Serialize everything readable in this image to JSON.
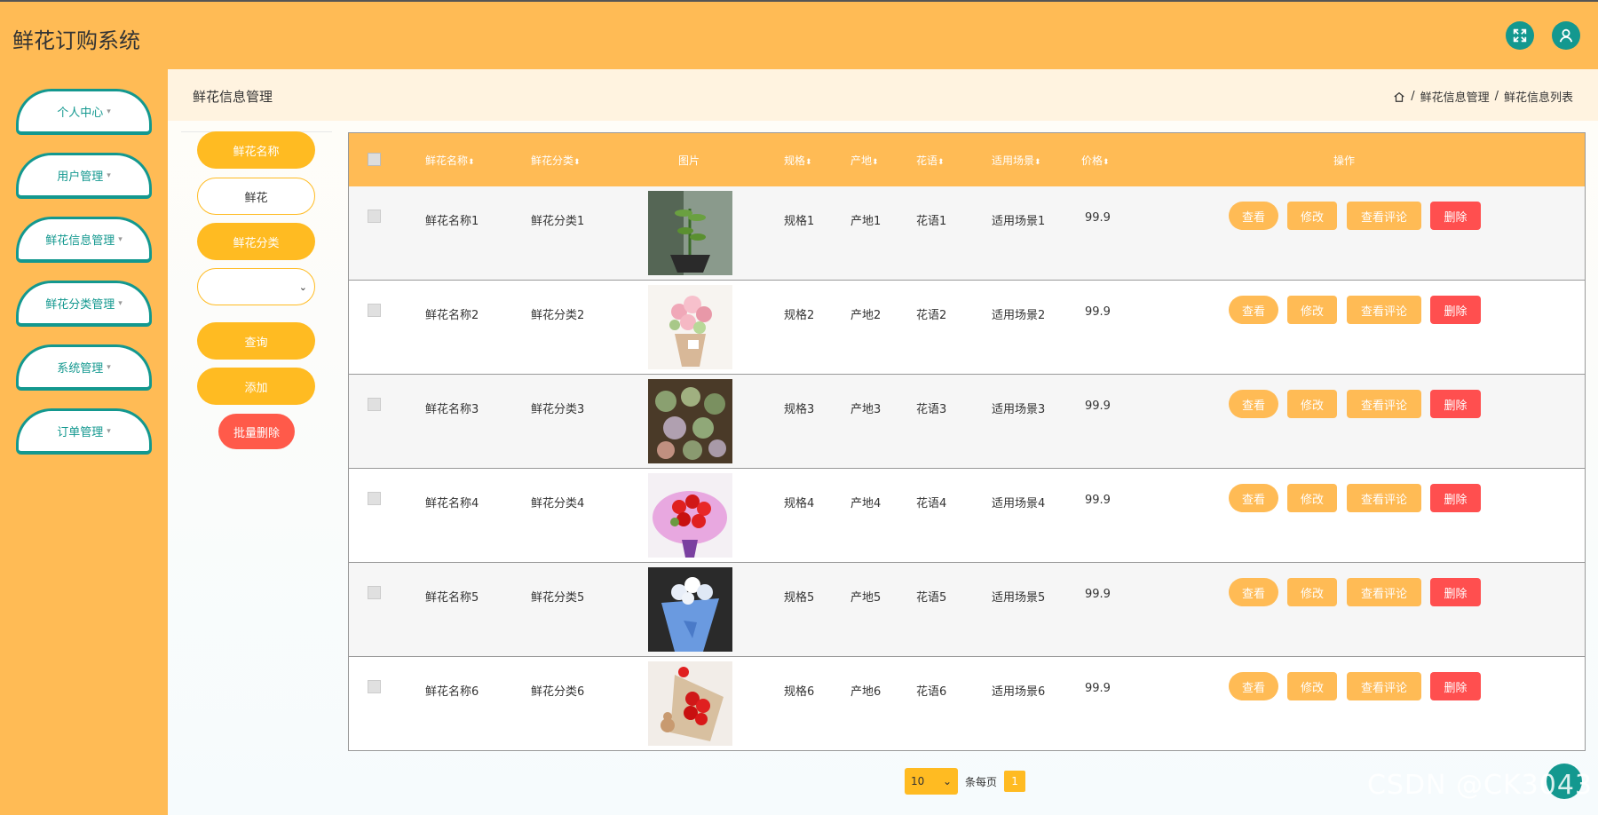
{
  "header": {
    "app_title": "鲜花订购系统",
    "icons": [
      "fullscreen-icon",
      "user-icon"
    ],
    "accent_color": "#ffbb55",
    "teal_color": "#13988f"
  },
  "sidebar": {
    "items": [
      {
        "label": "个人中心"
      },
      {
        "label": "用户管理"
      },
      {
        "label": "鲜花信息管理"
      },
      {
        "label": "鲜花分类管理"
      },
      {
        "label": "系统管理"
      },
      {
        "label": "订单管理"
      }
    ]
  },
  "page": {
    "title": "鲜花信息管理",
    "breadcrumb": [
      "鲜花信息管理",
      "鲜花信息列表"
    ],
    "breadcrumb_sep": "/"
  },
  "search": {
    "name_label": "鲜花名称",
    "name_value": "鲜花",
    "category_label": "鲜花分类",
    "category_value": "",
    "query_button": "查询",
    "add_button": "添加",
    "batch_delete_button": "批量删除"
  },
  "table": {
    "columns": [
      "鲜花名称",
      "鲜花分类",
      "图片",
      "规格",
      "产地",
      "花语",
      "适用场景",
      "价格",
      "操作"
    ],
    "rows": [
      {
        "name": "鲜花名称1",
        "category": "鲜花分类1",
        "image": "plant-bonsai",
        "spec": "规格1",
        "origin": "产地1",
        "language": "花语1",
        "scene": "适用场景1",
        "price": "99.9"
      },
      {
        "name": "鲜花名称2",
        "category": "鲜花分类2",
        "image": "pink-bouquet",
        "spec": "规格2",
        "origin": "产地2",
        "language": "花语2",
        "scene": "适用场景2",
        "price": "99.9"
      },
      {
        "name": "鲜花名称3",
        "category": "鲜花分类3",
        "image": "succulents",
        "spec": "规格3",
        "origin": "产地3",
        "language": "花语3",
        "scene": "适用场景3",
        "price": "99.9"
      },
      {
        "name": "鲜花名称4",
        "category": "鲜花分类4",
        "image": "red-carnations",
        "spec": "规格4",
        "origin": "产地4",
        "language": "花语4",
        "scene": "适用场景4",
        "price": "99.9"
      },
      {
        "name": "鲜花名称5",
        "category": "鲜花分类5",
        "image": "blue-bouquet",
        "spec": "规格5",
        "origin": "产地5",
        "language": "花语5",
        "scene": "适用场景5",
        "price": "99.9"
      },
      {
        "name": "鲜花名称6",
        "category": "鲜花分类6",
        "image": "red-roses-bear",
        "spec": "规格6",
        "origin": "产地6",
        "language": "花语6",
        "scene": "适用场景6",
        "price": "99.9"
      }
    ],
    "actions": {
      "view": "查看",
      "edit": "修改",
      "comments": "查看评论",
      "delete": "删除"
    }
  },
  "pagination": {
    "page_size": "10",
    "per_page_label": "条每页",
    "current_page": "1"
  },
  "watermark": "CSDN @CK3043"
}
